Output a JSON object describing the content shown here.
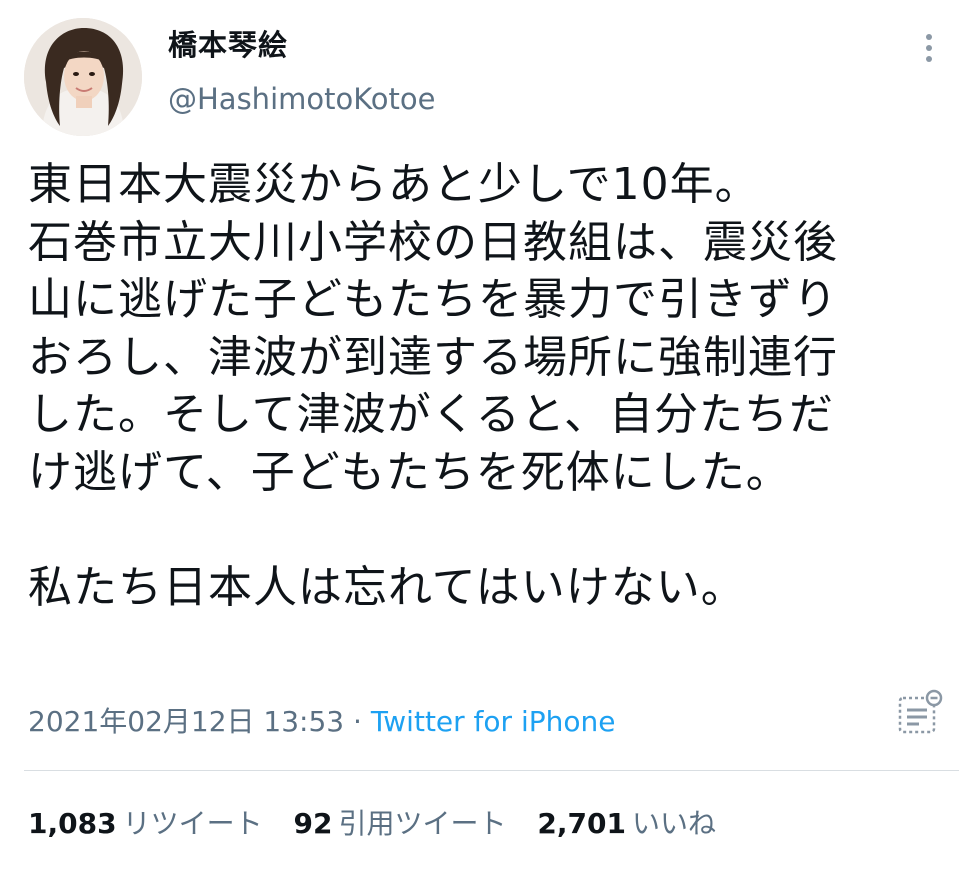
{
  "author": {
    "display_name": "橋本琴絵",
    "handle": "@HashimotoKotoe"
  },
  "icons": {
    "more": "vertical-ellipsis-icon",
    "analytics": "analytics-icon"
  },
  "tweet": {
    "paragraph1": [
      "東日本大震災からあと少しで10年。",
      "石巻市立大川小学校の日教組は、震災後",
      "山に逃げた子どもたちを暴力で引きずり",
      "おろし、津波が到達する場所に強制連行",
      "した。そして津波がくると、自分たちだ",
      "け逃げて、子どもたちを死体にした。"
    ],
    "paragraph2": "私たち日本人は忘れてはいけない。"
  },
  "meta": {
    "timestamp": "2021年02月12日 13:53",
    "separator": " · ",
    "source": "Twitter for iPhone"
  },
  "stats": {
    "retweets_count": "1,083",
    "retweets_label": "リツイート",
    "quotes_count": "92",
    "quotes_label": "引用ツイート",
    "likes_count": "2,701",
    "likes_label": "いいね"
  },
  "colors": {
    "text": "#0f1419",
    "secondary": "#5b7083",
    "link": "#1da1f2",
    "divider": "#d9dee2"
  }
}
